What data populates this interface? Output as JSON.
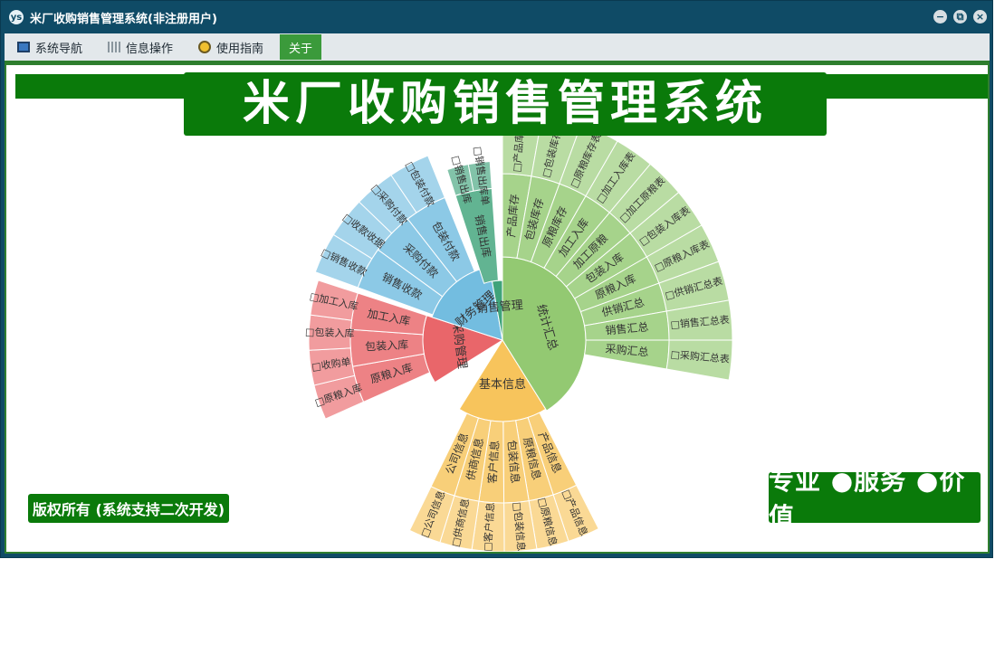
{
  "window": {
    "title": "米厂收购销售管理系统(非注册用户)",
    "app_icon": "ys",
    "minimize": "−",
    "restore": "⧉",
    "close": "×"
  },
  "menu": {
    "items": [
      {
        "label": "系统导航",
        "icon": "monitor-icon"
      },
      {
        "label": "信息操作",
        "icon": "grid-icon"
      },
      {
        "label": "使用指南",
        "icon": "guide-icon"
      },
      {
        "label": "关于",
        "icon": ""
      }
    ],
    "active_index": 3
  },
  "banner": {
    "title": "米厂收购销售管理系统"
  },
  "footer_left": "版权所有 (系统支持二次开发)",
  "footer_right": "专业 ●服务 ●价值",
  "sunburst": {
    "center": [
      {
        "label": "统计汇总",
        "color": "#93c972"
      },
      {
        "label": "基本信息",
        "color": "#f7c45c"
      },
      {
        "label": "采购管理",
        "color": "#e9666a"
      },
      {
        "label": "财务管理",
        "color": "#73bde0"
      },
      {
        "label": "销售管理",
        "color": "#3fa37a"
      }
    ],
    "branches": [
      {
        "group": "统计汇总",
        "items": [
          "产品库存",
          "包装库存",
          "原粮库存",
          "加工入库",
          "加工原粮",
          "包装入库",
          "原粮入库",
          "供销汇总",
          "销售汇总",
          "采购汇总"
        ],
        "leaves": [
          "产品库存表",
          "包装库存表",
          "原粮库存表",
          "加工入库表",
          "加工原粮表",
          "包装入库表",
          "原粮入库表",
          "供销汇总表",
          "销售汇总表",
          "采购汇总表"
        ]
      },
      {
        "group": "基本信息",
        "items": [
          "产品信息",
          "原粮信息",
          "包装信息",
          "客户信息",
          "供商信息",
          "公司信息"
        ],
        "leaves": [
          "产品信息",
          "原粮信息",
          "包装信息",
          "客户信息",
          "供商信息",
          "公司信息"
        ]
      },
      {
        "group": "采购管理",
        "items": [
          "原粮入库",
          "包装入库",
          "加工入库"
        ],
        "leaves": [
          "原粮入库",
          "收购单",
          "包装入库",
          "加工入库"
        ]
      },
      {
        "group": "财务管理",
        "items": [
          "销售收款",
          "采购付款",
          "包装付款"
        ],
        "leaves": [
          "销售收款",
          "收款收据",
          "采购付款",
          "包装付款"
        ]
      },
      {
        "group": "销售管理",
        "items": [
          "销售出库"
        ],
        "leaves": [
          "销售出库",
          "销售出库单"
        ]
      }
    ]
  }
}
